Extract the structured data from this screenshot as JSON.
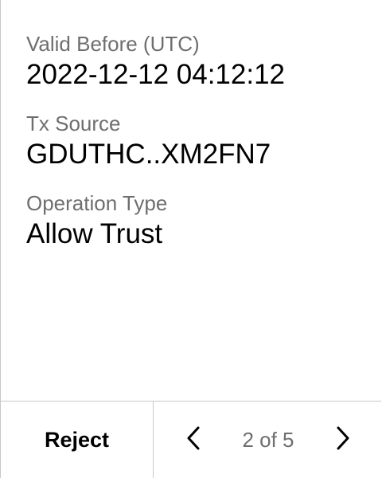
{
  "fields": [
    {
      "label": "Valid Before (UTC)",
      "value": "2022-12-12 04:12:12"
    },
    {
      "label": "Tx Source",
      "value": "GDUTHC..XM2FN7"
    },
    {
      "label": "Operation Type",
      "value": "Allow Trust"
    }
  ],
  "footer": {
    "reject_label": "Reject",
    "prev_icon": "chevron-left-icon",
    "next_icon": "chevron-right-icon",
    "page_indicator": "2 of 5"
  },
  "colors": {
    "label": "#6e6e6e",
    "value": "#000000",
    "divider": "#c8c8c8",
    "background": "#ffffff"
  }
}
